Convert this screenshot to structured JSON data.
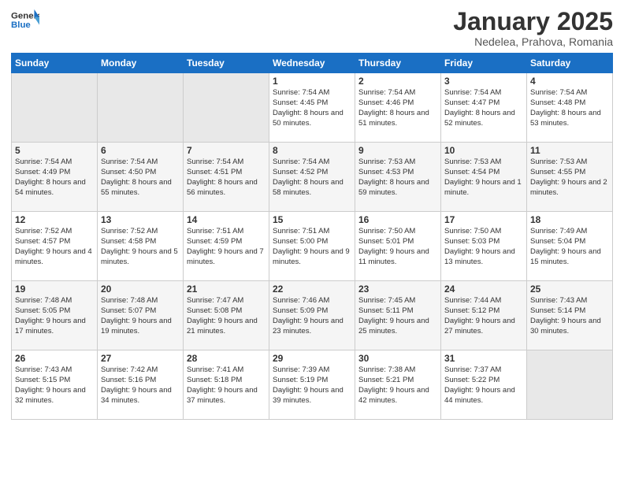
{
  "header": {
    "logo_line1": "General",
    "logo_line2": "Blue",
    "title": "January 2025",
    "subtitle": "Nedelea, Prahova, Romania"
  },
  "weekdays": [
    "Sunday",
    "Monday",
    "Tuesday",
    "Wednesday",
    "Thursday",
    "Friday",
    "Saturday"
  ],
  "weeks": [
    [
      {
        "day": "",
        "sunrise": "",
        "sunset": "",
        "daylight": "",
        "empty": true
      },
      {
        "day": "",
        "sunrise": "",
        "sunset": "",
        "daylight": "",
        "empty": true
      },
      {
        "day": "",
        "sunrise": "",
        "sunset": "",
        "daylight": "",
        "empty": true
      },
      {
        "day": "1",
        "sunrise": "Sunrise: 7:54 AM",
        "sunset": "Sunset: 4:45 PM",
        "daylight": "Daylight: 8 hours and 50 minutes."
      },
      {
        "day": "2",
        "sunrise": "Sunrise: 7:54 AM",
        "sunset": "Sunset: 4:46 PM",
        "daylight": "Daylight: 8 hours and 51 minutes."
      },
      {
        "day": "3",
        "sunrise": "Sunrise: 7:54 AM",
        "sunset": "Sunset: 4:47 PM",
        "daylight": "Daylight: 8 hours and 52 minutes."
      },
      {
        "day": "4",
        "sunrise": "Sunrise: 7:54 AM",
        "sunset": "Sunset: 4:48 PM",
        "daylight": "Daylight: 8 hours and 53 minutes."
      }
    ],
    [
      {
        "day": "5",
        "sunrise": "Sunrise: 7:54 AM",
        "sunset": "Sunset: 4:49 PM",
        "daylight": "Daylight: 8 hours and 54 minutes."
      },
      {
        "day": "6",
        "sunrise": "Sunrise: 7:54 AM",
        "sunset": "Sunset: 4:50 PM",
        "daylight": "Daylight: 8 hours and 55 minutes."
      },
      {
        "day": "7",
        "sunrise": "Sunrise: 7:54 AM",
        "sunset": "Sunset: 4:51 PM",
        "daylight": "Daylight: 8 hours and 56 minutes."
      },
      {
        "day": "8",
        "sunrise": "Sunrise: 7:54 AM",
        "sunset": "Sunset: 4:52 PM",
        "daylight": "Daylight: 8 hours and 58 minutes."
      },
      {
        "day": "9",
        "sunrise": "Sunrise: 7:53 AM",
        "sunset": "Sunset: 4:53 PM",
        "daylight": "Daylight: 8 hours and 59 minutes."
      },
      {
        "day": "10",
        "sunrise": "Sunrise: 7:53 AM",
        "sunset": "Sunset: 4:54 PM",
        "daylight": "Daylight: 9 hours and 1 minute."
      },
      {
        "day": "11",
        "sunrise": "Sunrise: 7:53 AM",
        "sunset": "Sunset: 4:55 PM",
        "daylight": "Daylight: 9 hours and 2 minutes."
      }
    ],
    [
      {
        "day": "12",
        "sunrise": "Sunrise: 7:52 AM",
        "sunset": "Sunset: 4:57 PM",
        "daylight": "Daylight: 9 hours and 4 minutes."
      },
      {
        "day": "13",
        "sunrise": "Sunrise: 7:52 AM",
        "sunset": "Sunset: 4:58 PM",
        "daylight": "Daylight: 9 hours and 5 minutes."
      },
      {
        "day": "14",
        "sunrise": "Sunrise: 7:51 AM",
        "sunset": "Sunset: 4:59 PM",
        "daylight": "Daylight: 9 hours and 7 minutes."
      },
      {
        "day": "15",
        "sunrise": "Sunrise: 7:51 AM",
        "sunset": "Sunset: 5:00 PM",
        "daylight": "Daylight: 9 hours and 9 minutes."
      },
      {
        "day": "16",
        "sunrise": "Sunrise: 7:50 AM",
        "sunset": "Sunset: 5:01 PM",
        "daylight": "Daylight: 9 hours and 11 minutes."
      },
      {
        "day": "17",
        "sunrise": "Sunrise: 7:50 AM",
        "sunset": "Sunset: 5:03 PM",
        "daylight": "Daylight: 9 hours and 13 minutes."
      },
      {
        "day": "18",
        "sunrise": "Sunrise: 7:49 AM",
        "sunset": "Sunset: 5:04 PM",
        "daylight": "Daylight: 9 hours and 15 minutes."
      }
    ],
    [
      {
        "day": "19",
        "sunrise": "Sunrise: 7:48 AM",
        "sunset": "Sunset: 5:05 PM",
        "daylight": "Daylight: 9 hours and 17 minutes."
      },
      {
        "day": "20",
        "sunrise": "Sunrise: 7:48 AM",
        "sunset": "Sunset: 5:07 PM",
        "daylight": "Daylight: 9 hours and 19 minutes."
      },
      {
        "day": "21",
        "sunrise": "Sunrise: 7:47 AM",
        "sunset": "Sunset: 5:08 PM",
        "daylight": "Daylight: 9 hours and 21 minutes."
      },
      {
        "day": "22",
        "sunrise": "Sunrise: 7:46 AM",
        "sunset": "Sunset: 5:09 PM",
        "daylight": "Daylight: 9 hours and 23 minutes."
      },
      {
        "day": "23",
        "sunrise": "Sunrise: 7:45 AM",
        "sunset": "Sunset: 5:11 PM",
        "daylight": "Daylight: 9 hours and 25 minutes."
      },
      {
        "day": "24",
        "sunrise": "Sunrise: 7:44 AM",
        "sunset": "Sunset: 5:12 PM",
        "daylight": "Daylight: 9 hours and 27 minutes."
      },
      {
        "day": "25",
        "sunrise": "Sunrise: 7:43 AM",
        "sunset": "Sunset: 5:14 PM",
        "daylight": "Daylight: 9 hours and 30 minutes."
      }
    ],
    [
      {
        "day": "26",
        "sunrise": "Sunrise: 7:43 AM",
        "sunset": "Sunset: 5:15 PM",
        "daylight": "Daylight: 9 hours and 32 minutes."
      },
      {
        "day": "27",
        "sunrise": "Sunrise: 7:42 AM",
        "sunset": "Sunset: 5:16 PM",
        "daylight": "Daylight: 9 hours and 34 minutes."
      },
      {
        "day": "28",
        "sunrise": "Sunrise: 7:41 AM",
        "sunset": "Sunset: 5:18 PM",
        "daylight": "Daylight: 9 hours and 37 minutes."
      },
      {
        "day": "29",
        "sunrise": "Sunrise: 7:39 AM",
        "sunset": "Sunset: 5:19 PM",
        "daylight": "Daylight: 9 hours and 39 minutes."
      },
      {
        "day": "30",
        "sunrise": "Sunrise: 7:38 AM",
        "sunset": "Sunset: 5:21 PM",
        "daylight": "Daylight: 9 hours and 42 minutes."
      },
      {
        "day": "31",
        "sunrise": "Sunrise: 7:37 AM",
        "sunset": "Sunset: 5:22 PM",
        "daylight": "Daylight: 9 hours and 44 minutes."
      },
      {
        "day": "",
        "sunrise": "",
        "sunset": "",
        "daylight": "",
        "empty": true
      }
    ]
  ]
}
